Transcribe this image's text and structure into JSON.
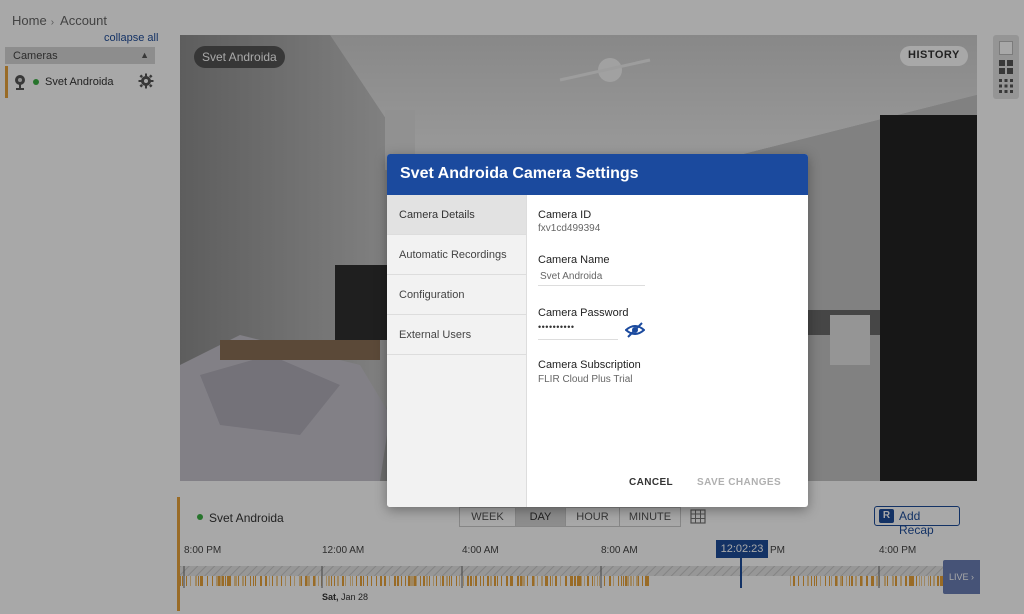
{
  "breadcrumb": {
    "home": "Home",
    "separator": "›",
    "account": "Account"
  },
  "sidebar": {
    "collapse_all": "collapse all",
    "section_label": "Cameras",
    "camera_name": "Svet Androida"
  },
  "video": {
    "camera_label": "Svet Androida",
    "history_label": "HISTORY"
  },
  "timeline": {
    "camera_name": "Svet Androida",
    "tabs": [
      "WEEK",
      "DAY",
      "HOUR",
      "MINUTE"
    ],
    "active_tab": "DAY",
    "add_recap_label": "Add Recap",
    "recap_badge": "R",
    "ticks": [
      "8:00 PM",
      "12:00 AM",
      "4:00 AM",
      "8:00 AM",
      "PM",
      "4:00 PM"
    ],
    "date_day": "Sat,",
    "date_rest": " Jan 28",
    "current_time": "12:02:23",
    "live_label": "LIVE ›"
  },
  "modal": {
    "title": "Svet Androida Camera Settings",
    "nav_items": [
      "Camera Details",
      "Automatic Recordings",
      "Configuration",
      "External Users"
    ],
    "active_nav": "Camera Details",
    "fields": {
      "camera_id_label": "Camera ID",
      "camera_id_value": "fxv1cd499394",
      "camera_name_label": "Camera Name",
      "camera_name_value": "Svet Androida",
      "password_label": "Camera Password",
      "password_value": "••••••••••",
      "subscription_label": "Camera Subscription",
      "subscription_value": "FLIR Cloud Plus Trial"
    },
    "cancel_label": "CANCEL",
    "save_label": "SAVE CHANGES"
  },
  "icons": {
    "camera": "camera-icon",
    "gear": "gear-icon",
    "eye": "eye-slash-icon",
    "calendar": "calendar-icon"
  },
  "colors": {
    "brand_blue": "#1b4a9e",
    "accent_orange": "#e8a33b",
    "online_green": "#3cb043"
  }
}
